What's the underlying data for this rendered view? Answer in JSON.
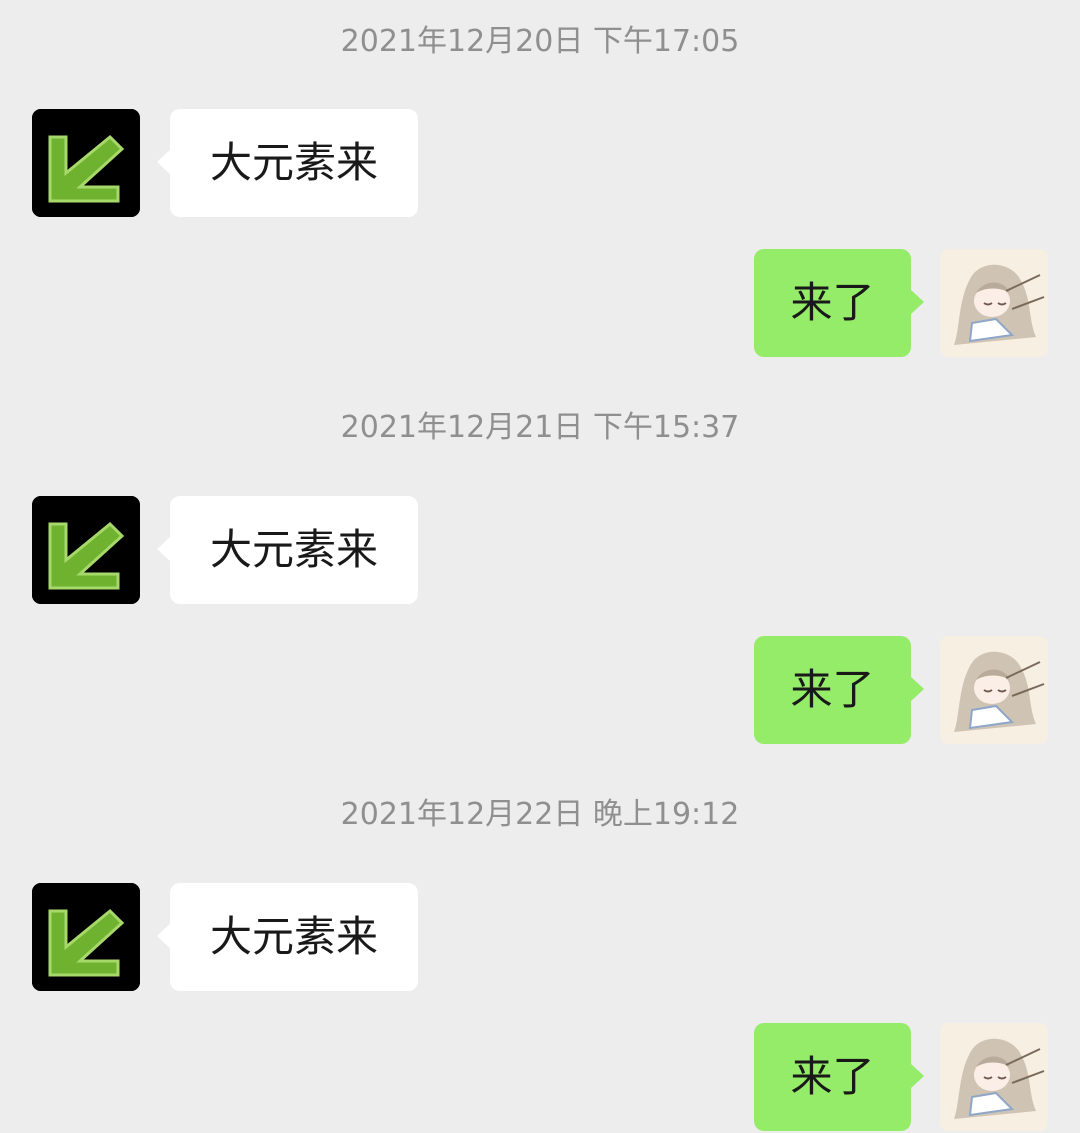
{
  "colors": {
    "background": "#ededed",
    "incoming_bubble": "#ffffff",
    "outgoing_bubble": "#95ec69",
    "timestamp_text": "#8f8f8f",
    "message_text": "#191919"
  },
  "messages": [
    {
      "timestamp": "2021年12月20日 下午17:05",
      "incoming": {
        "text": "大元素来",
        "avatar_icon": "green-arrow-avatar-icon"
      },
      "outgoing": {
        "text": "来了",
        "avatar_icon": "anime-girl-avatar-icon"
      }
    },
    {
      "timestamp": "2021年12月21日 下午15:37",
      "incoming": {
        "text": "大元素来",
        "avatar_icon": "green-arrow-avatar-icon"
      },
      "outgoing": {
        "text": "来了",
        "avatar_icon": "anime-girl-avatar-icon"
      }
    },
    {
      "timestamp": "2021年12月22日 晚上19:12",
      "incoming": {
        "text": "大元素来",
        "avatar_icon": "green-arrow-avatar-icon"
      },
      "outgoing": {
        "text": "来了",
        "avatar_icon": "anime-girl-avatar-icon"
      }
    }
  ]
}
